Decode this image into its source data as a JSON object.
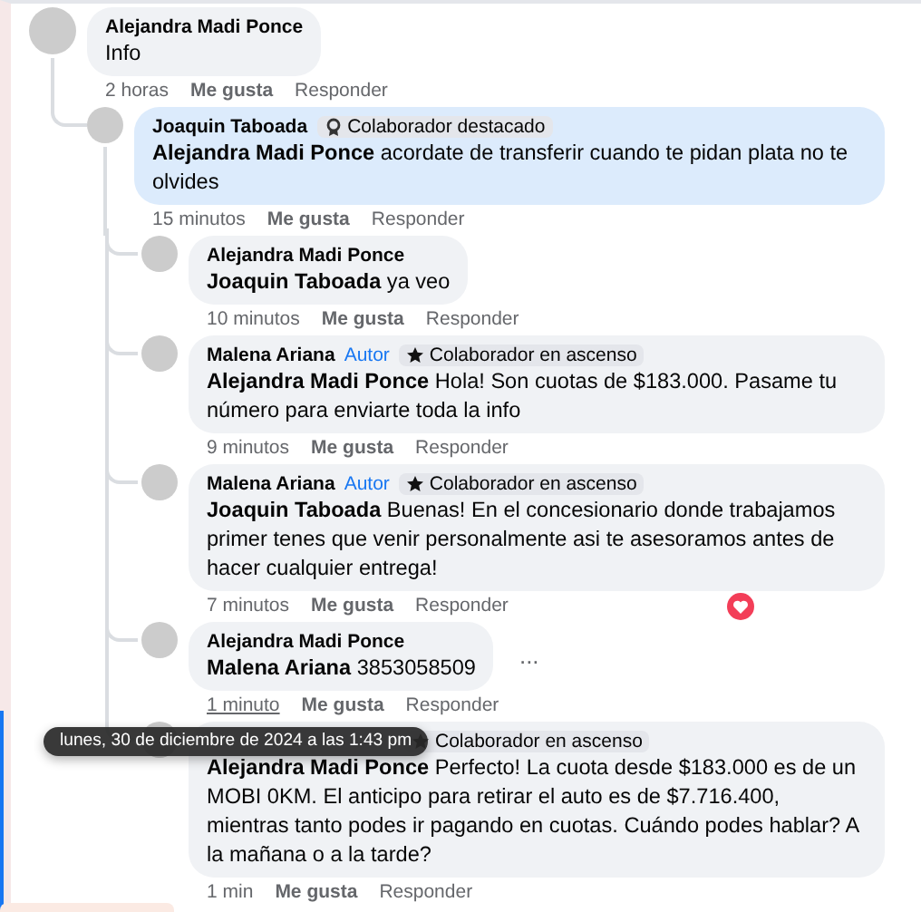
{
  "comments": [
    {
      "author": "Alejandra Madi Ponce",
      "text": "Info",
      "time": "2 horas",
      "like": "Me gusta",
      "reply": "Responder",
      "children": [
        {
          "author": "Joaquin Taboada",
          "highlighted": true,
          "badge": {
            "kind": "featured",
            "label": "Colaborador destacado"
          },
          "text": "**Alejandra Madi Ponce** acordate de transferir cuando te pidan plata no te olvides",
          "time": "15 minutos",
          "like": "Me gusta",
          "reply": "Responder",
          "children": [
            {
              "author": "Alejandra Madi Ponce",
              "text": "**Joaquin Taboada** ya veo",
              "time": "10 minutos",
              "like": "Me gusta",
              "reply": "Responder"
            },
            {
              "author": "Malena Ariana",
              "author_tag": "Autor",
              "badge": {
                "kind": "rising",
                "label": "Colaborador en ascenso"
              },
              "text": "**Alejandra Madi Ponce** Hola! Son cuotas de $183.000. Pasame tu número para enviarte toda la info",
              "time": "9 minutos",
              "like": "Me gusta",
              "reply": "Responder"
            },
            {
              "author": "Malena Ariana",
              "author_tag": "Autor",
              "badge": {
                "kind": "rising",
                "label": "Colaborador en ascenso"
              },
              "text": "**Joaquin Taboada** Buenas! En el concesionario donde trabajamos primer tenes que venir personalmente asi te asesoramos antes de hacer cualquier entrega!",
              "time": "7 minutos",
              "like": "Me gusta",
              "reply": "Responder",
              "reaction": true
            },
            {
              "author": "Alejandra Madi Ponce",
              "text": "**Malena Ariana** 3853058509",
              "time": "1 minuto",
              "time_hovered": true,
              "more": "...",
              "like": "Me gusta",
              "reply": "Responder"
            },
            {
              "badge": {
                "kind": "rising",
                "label": "Colaborador en ascenso"
              },
              "text": "**Alejandra Madi Ponce** Perfecto! La cuota desde $183.000 es de un MOBI 0KM. El anticipo para retirar el auto es de $7.716.400, mientras tanto podes ir pagando en cuotas. Cuándo podes hablar? A la mañana o a la tarde?",
              "time": "1 min",
              "like": "Me gusta",
              "reply": "Responder",
              "selected": true
            }
          ]
        }
      ]
    }
  ],
  "tooltip": "lunes, 30 de diciembre de 2024 a las 1:43 pm"
}
